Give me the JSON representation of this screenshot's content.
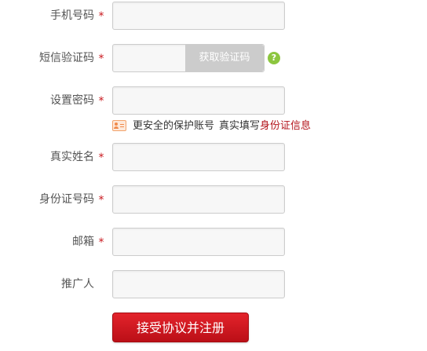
{
  "form": {
    "phone": {
      "label": "手机号码",
      "required_mark": "*",
      "value": "",
      "placeholder": ""
    },
    "sms_code": {
      "label": "短信验证码",
      "required_mark": "*",
      "value": "",
      "placeholder": "",
      "get_code_label": "获取验证码",
      "help_icon": "question-icon",
      "help_glyph": "?"
    },
    "password": {
      "label": "设置密码",
      "required_mark": "*",
      "value": "",
      "placeholder": ""
    },
    "notice": {
      "icon": "id-card-icon",
      "text_main": "更安全的保护账号",
      "text_prefix": "真实填写",
      "text_link": "身份证信息"
    },
    "real_name": {
      "label": "真实姓名",
      "required_mark": "*",
      "value": "",
      "placeholder": ""
    },
    "id_number": {
      "label": "身份证号码",
      "required_mark": "*",
      "value": "",
      "placeholder": ""
    },
    "email": {
      "label": "邮箱",
      "required_mark": "*",
      "value": "",
      "placeholder": ""
    },
    "referrer": {
      "label": "推广人",
      "value": "",
      "placeholder": ""
    },
    "submit_label": "接受协议并注册"
  },
  "colors": {
    "required": "#c8161d",
    "link": "#b3141b",
    "submit_button": "#d71920",
    "code_button": "#cccccc",
    "help_icon": "#8cc63f",
    "field_background": "#f7f7f7",
    "field_border": "#cccccc"
  }
}
